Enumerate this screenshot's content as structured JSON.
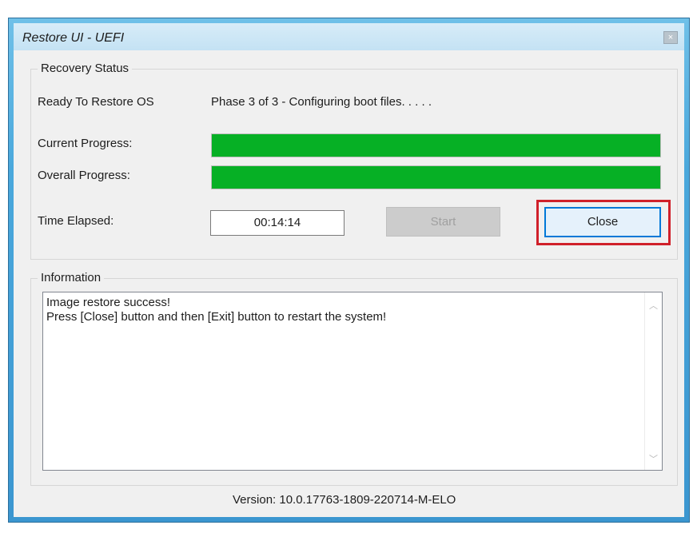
{
  "window": {
    "title": "Restore UI - UEFI",
    "close_glyph": "×"
  },
  "recovery_status": {
    "legend": "Recovery Status",
    "state_label": "Ready To Restore OS",
    "phase_text": "Phase 3 of 3 - Configuring boot files. . . . .",
    "current_progress_label": "Current Progress:",
    "current_progress_percent": 100,
    "overall_progress_label": "Overall Progress:",
    "overall_progress_percent": 100,
    "time_elapsed_label": "Time Elapsed:",
    "time_elapsed_value": "00:14:14",
    "start_button_label": "Start",
    "close_button_label": "Close"
  },
  "information": {
    "legend": "Information",
    "lines": [
      "Image restore success!",
      "Press [Close] button and then [Exit] button to restart the system!"
    ],
    "scroll_up_glyph": "︿",
    "scroll_down_glyph": "﹀"
  },
  "footer": {
    "version": "Version: 10.0.17763-1809-220714-M-ELO"
  },
  "colors": {
    "progress_fill": "#06b025",
    "highlight": "#d0202a",
    "close_button_border": "#0078d7"
  }
}
